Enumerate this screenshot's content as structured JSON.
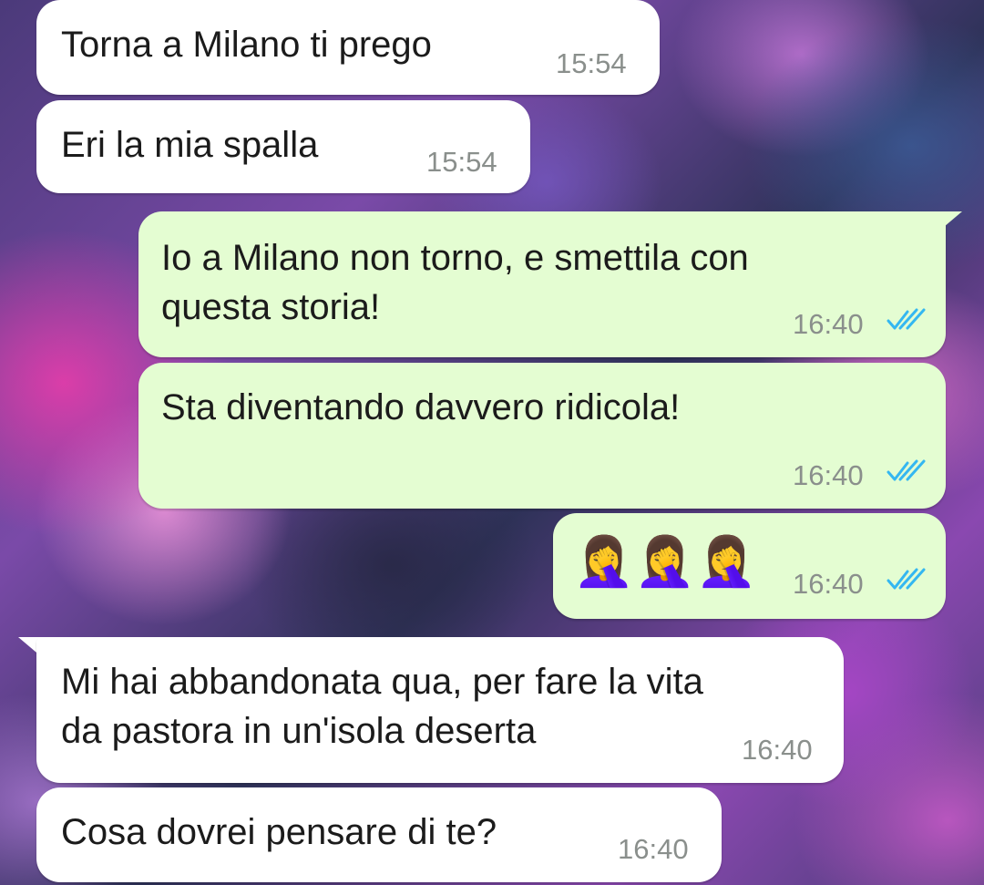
{
  "messages": [
    {
      "direction": "incoming",
      "text": "Torna a Milano ti prego",
      "time": "15:54"
    },
    {
      "direction": "incoming",
      "text": "Eri la mia spalla",
      "time": "15:54"
    },
    {
      "direction": "outgoing",
      "text_line1": "Io a Milano non torno, e smettila con",
      "text_line2": "questa storia!",
      "time": "16:40",
      "status": "read"
    },
    {
      "direction": "outgoing",
      "text": "Sta diventando davvero ridicola!",
      "time": "16:40",
      "status": "read"
    },
    {
      "direction": "outgoing",
      "emoji": "🤦‍♀️🤦‍♀️🤦‍♀️",
      "emoji_name": "woman-facepalming",
      "emoji_count": 3,
      "time": "16:40",
      "status": "read"
    },
    {
      "direction": "incoming",
      "text_line1": "Mi hai abbandonata qua, per fare la vita",
      "text_line2": "da pastora in un'isola deserta",
      "time": "16:40"
    },
    {
      "direction": "incoming",
      "text": "Cosa dovrei pensare di te?",
      "time": "16:40"
    }
  ],
  "colors": {
    "incoming_bubble": "#ffffff",
    "outgoing_bubble": "#e4fdd2",
    "read_ticks": "#34b7f1",
    "time_text": "#8a8f8c"
  }
}
